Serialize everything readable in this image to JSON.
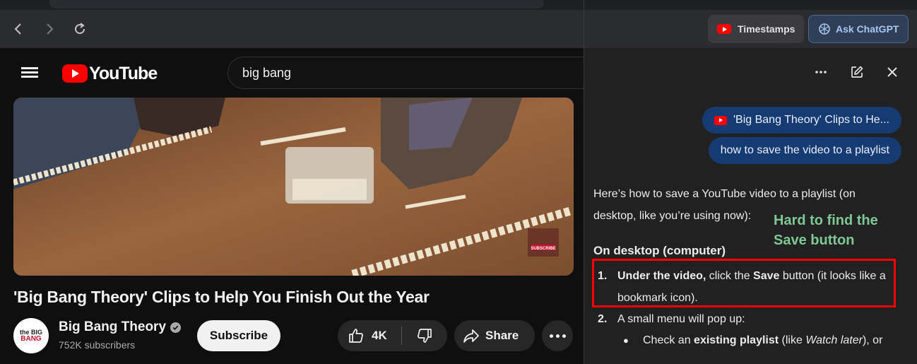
{
  "browser": {
    "nav": {
      "back": "chevron-left-icon",
      "forward": "chevron-right-icon",
      "reload": "reload-icon"
    }
  },
  "youtube": {
    "logo_text": "YouTube",
    "search_value": "big bang",
    "video": {
      "title": "'Big Bang Theory' Clips to Help You Finish Out the Year",
      "thumbnail_badge": "SUBSCRIBE"
    },
    "channel": {
      "avatar_line1": "the BIG",
      "avatar_line2": "BANG",
      "name": "Big Bang Theory",
      "subscribers": "752K subscribers"
    },
    "actions": {
      "subscribe": "Subscribe",
      "like_count": "4K",
      "share": "Share"
    }
  },
  "extension": {
    "timestamps_label": "Timestamps",
    "ask_chatgpt_label": "Ask ChatGPT",
    "messages": {
      "video_pill": "'Big Bang Theory' Clips to He...",
      "question": "how to save the video to a playlist"
    },
    "answer": {
      "intro": "Here’s how to save a YouTube video to a playlist (on desktop, like you’re using now):",
      "heading": "On desktop (computer)",
      "step1_num": "1.",
      "step1_bold_a": "Under the video,",
      "step1_text_a": " click the ",
      "step1_bold_b": "Save",
      "step1_text_b": " button (it looks like a bookmark icon).",
      "step2_num": "2.",
      "step2_text": "A small menu will pop up:",
      "bullet_text_a": "Check an ",
      "bullet_bold": "existing playlist",
      "bullet_text_b": " (like ",
      "bullet_italic": "Watch later",
      "bullet_text_c": "), or"
    }
  },
  "annotation": {
    "text": "Hard to find the Save button",
    "color": "#7fc794",
    "box_color": "#ff0000"
  }
}
